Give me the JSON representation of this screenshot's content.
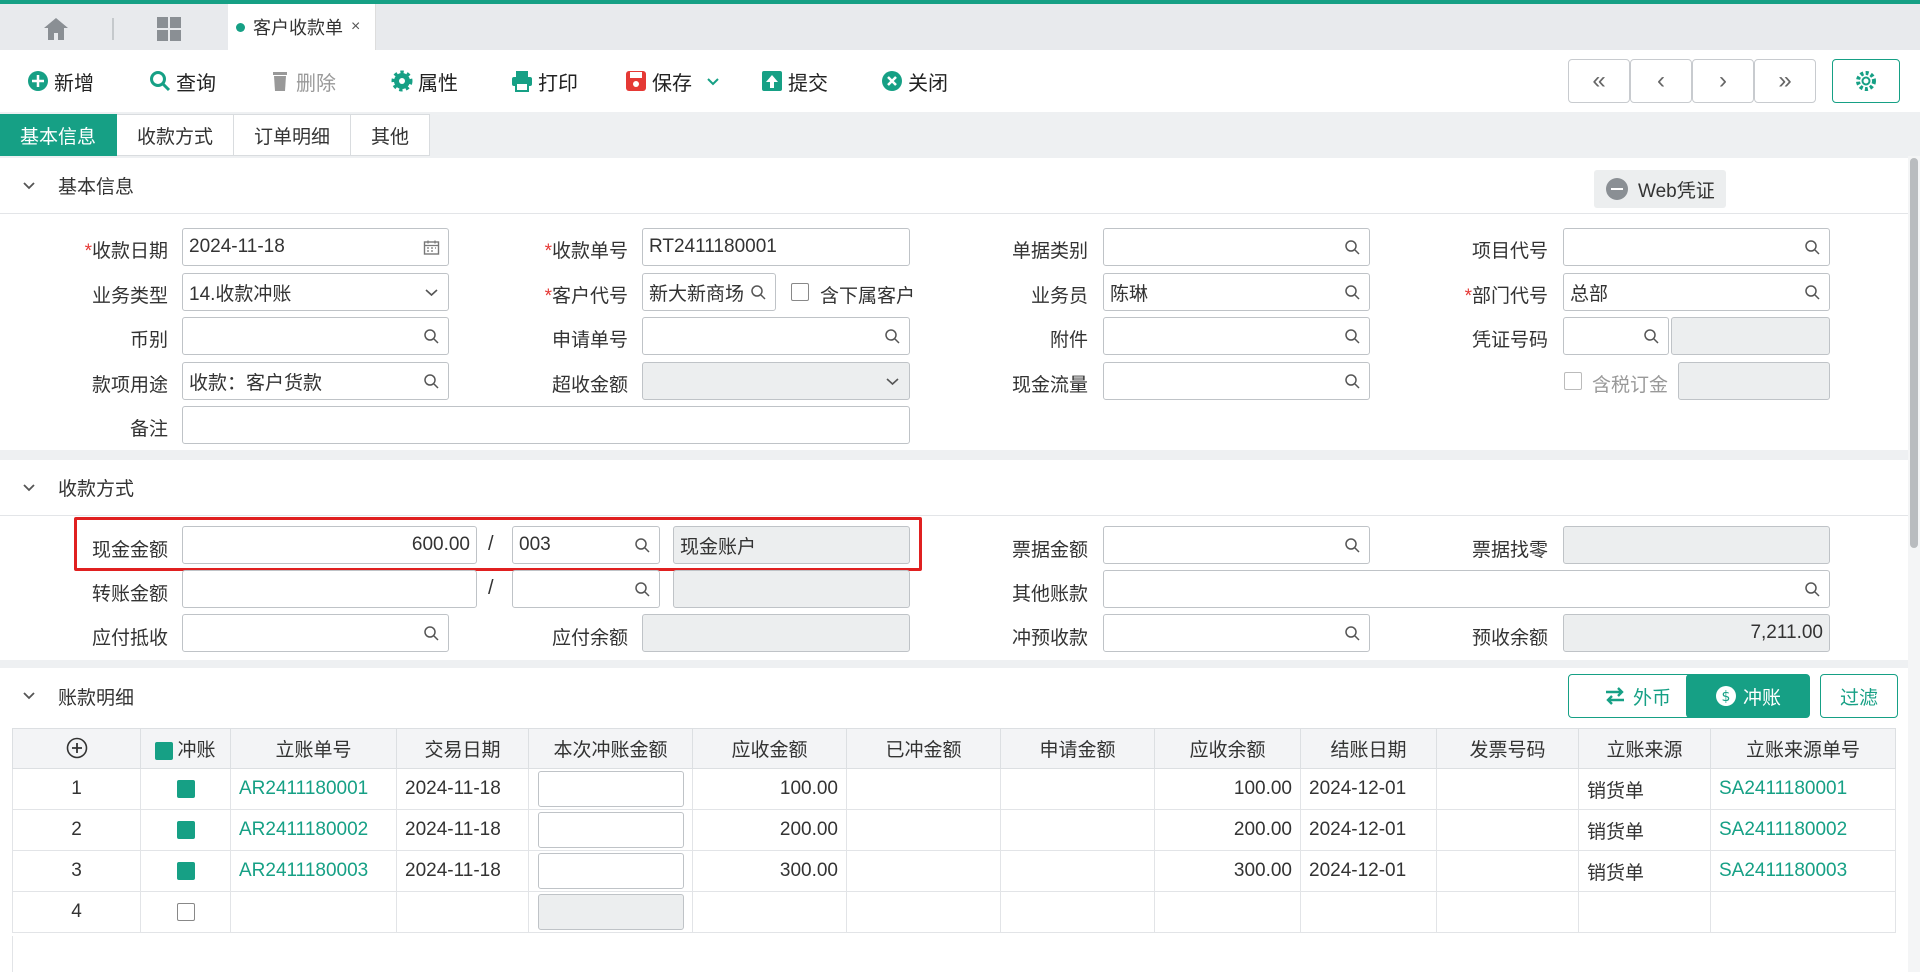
{
  "colors": {
    "accent": "#16a085",
    "required": "#e53935",
    "highlight": "#e02020"
  },
  "tabbar": {
    "home_icon": "home-icon",
    "grid_icon": "apps-grid-icon",
    "doc_tab": "客户收款单",
    "close": "×"
  },
  "toolbar": {
    "new": "新增",
    "query": "查询",
    "delete": "删除",
    "props": "属性",
    "print": "打印",
    "save": "保存",
    "submit": "提交",
    "close": "关闭"
  },
  "subtabs": [
    "基本信息",
    "收款方式",
    "订单明细",
    "其他"
  ],
  "basic": {
    "title": "基本信息",
    "web_voucher": "Web凭证",
    "date_label": "收款日期",
    "date": "2024-11-18",
    "no_label": "收款单号",
    "no": "RT2411180001",
    "doctype_label": "单据类别",
    "project_label": "项目代号",
    "biztype_label": "业务类型",
    "biztype": "14.收款冲账",
    "cust_label": "客户代号",
    "cust": "新大新商场",
    "sub_cust_label": "含下属客户",
    "sales_label": "业务员",
    "sales": "陈琳",
    "dept_label": "部门代号",
    "dept": "总部",
    "currency_label": "币别",
    "apply_label": "申请单号",
    "attach_label": "附件",
    "voucher_label": "凭证号码",
    "purpose_label": "款项用途",
    "purpose": "收款：客户货款",
    "over_label": "超收金额",
    "cashflow_label": "现金流量",
    "tax_label": "含税订金",
    "remark_label": "备注"
  },
  "payment": {
    "title": "收款方式",
    "cash_label": "现金金额",
    "cash": "600.00",
    "cash_acct_code": "003",
    "cash_acct_name": "现金账户",
    "bill_label": "票据金额",
    "bill_change_label": "票据找零",
    "transfer_label": "转账金额",
    "other_label": "其他账款",
    "offset_label": "应付抵收",
    "payable_bal_label": "应付余额",
    "prepay_label": "冲预收款",
    "prepay_bal_label": "预收余额",
    "prepay_bal": "7,211.00",
    "slash": "/"
  },
  "detail": {
    "title": "账款明细",
    "btn_fx": "外币",
    "btn_settle": "冲账",
    "btn_filter": "过滤",
    "headers": [
      "冲账",
      "立账单号",
      "交易日期",
      "本次冲账金额",
      "应收金额",
      "已冲金额",
      "申请金额",
      "应收余额",
      "结账日期",
      "发票号码",
      "立账来源",
      "立账来源单号"
    ],
    "rows": [
      {
        "n": "1",
        "checked": true,
        "no": "AR2411180001",
        "date": "2024-11-18",
        "amt": "100.00",
        "bal": "100.00",
        "close": "2024-12-01",
        "src": "销货单",
        "src_no": "SA2411180001"
      },
      {
        "n": "2",
        "checked": true,
        "no": "AR2411180002",
        "date": "2024-11-18",
        "amt": "200.00",
        "bal": "200.00",
        "close": "2024-12-01",
        "src": "销货单",
        "src_no": "SA2411180002"
      },
      {
        "n": "3",
        "checked": true,
        "no": "AR2411180003",
        "date": "2024-11-18",
        "amt": "300.00",
        "bal": "300.00",
        "close": "2024-12-01",
        "src": "销货单",
        "src_no": "SA2411180003"
      },
      {
        "n": "4",
        "checked": false,
        "no": "",
        "date": "",
        "amt": "",
        "bal": "",
        "close": "",
        "src": "",
        "src_no": ""
      }
    ]
  }
}
